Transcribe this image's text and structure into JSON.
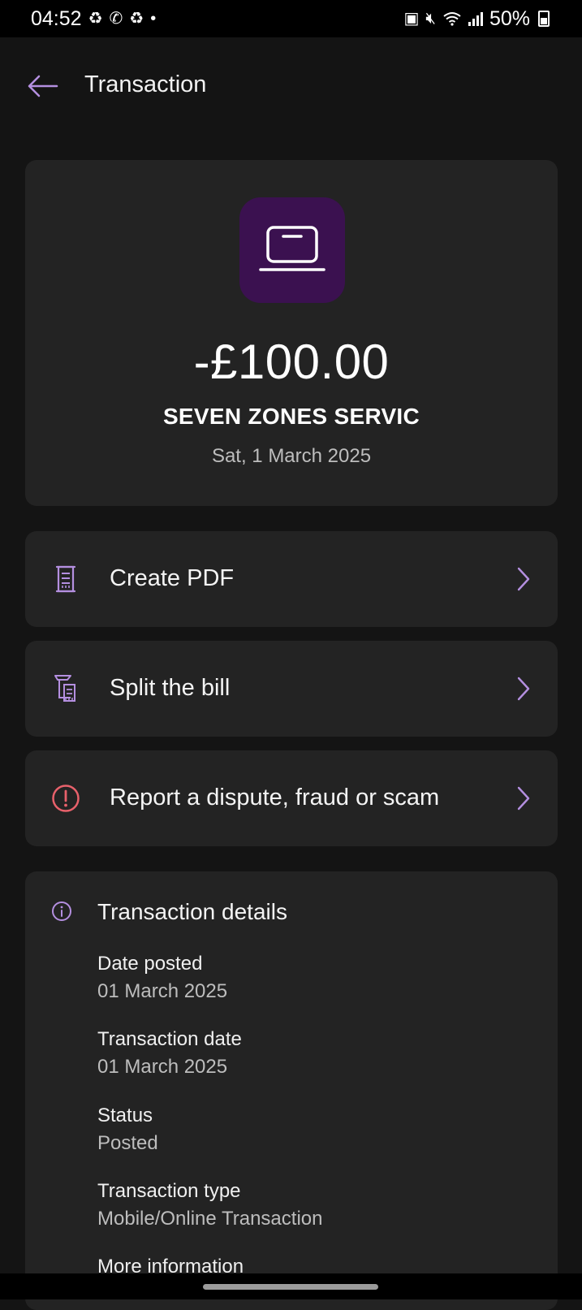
{
  "status_bar": {
    "time": "04:52",
    "battery": "50%",
    "notification_icons": [
      "recycle-icon",
      "whatsapp-icon",
      "recycle-icon",
      "dot-icon"
    ],
    "system_icons": [
      "nfc-icon",
      "mute-icon",
      "wifi-icon",
      "signal-icon",
      "battery-icon"
    ]
  },
  "header": {
    "title": "Transaction",
    "back_icon": "back-arrow-icon"
  },
  "summary": {
    "icon": "laptop-icon",
    "amount": "-£100.00",
    "merchant": "SEVEN ZONES SERVIC",
    "date": "Sat, 1 March 2025"
  },
  "actions": [
    {
      "label": "Create PDF",
      "icon": "receipt-icon"
    },
    {
      "label": "Split the bill",
      "icon": "split-bill-icon"
    },
    {
      "label": "Report a dispute, fraud or scam",
      "icon": "alert-icon"
    }
  ],
  "details": {
    "title": "Transaction details",
    "fields": [
      {
        "label": "Date posted",
        "value": "01 March 2025"
      },
      {
        "label": "Transaction date",
        "value": "01 March 2025"
      },
      {
        "label": "Status",
        "value": "Posted"
      },
      {
        "label": "Transaction type",
        "value": "Mobile/Online Transaction"
      },
      {
        "label": "More information",
        "value": ""
      }
    ]
  },
  "colors": {
    "background": "#141414",
    "card": "#232323",
    "accent": "#b48fe0",
    "icon_tile": "#3b1150",
    "alert": "#e8616b"
  }
}
